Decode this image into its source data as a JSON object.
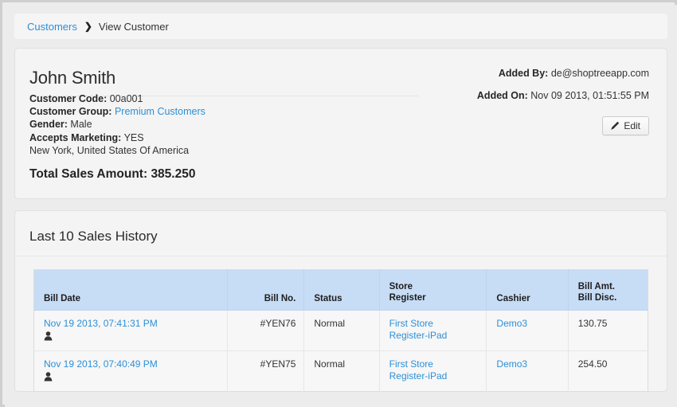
{
  "breadcrumb": {
    "root_label": "Customers",
    "separator": "❯",
    "current_label": "View Customer"
  },
  "customer": {
    "name": "John Smith",
    "fields": [
      {
        "label": "Customer Code:",
        "value": "00a001",
        "is_link": false
      },
      {
        "label": "Customer Group:",
        "value": "Premium Customers",
        "is_link": true
      },
      {
        "label": "Gender:",
        "value": "Male",
        "is_link": false
      },
      {
        "label": "Accepts Marketing:",
        "value": "YES",
        "is_link": false
      }
    ],
    "address": "New York, United States Of America",
    "total_sales_label": "Total Sales Amount:",
    "total_sales_value": "385.250",
    "added_by_label": "Added By:",
    "added_by_value": "de@shoptreeapp.com",
    "added_on_label": "Added On:",
    "added_on_value": "Nov 09 2013, 01:51:55 PM",
    "edit_label": "Edit"
  },
  "sales": {
    "title": "Last 10 Sales History",
    "columns": [
      {
        "key": "bill_date",
        "label": "Bill Date",
        "align": "left"
      },
      {
        "key": "bill_no",
        "label": "Bill No.",
        "align": "right"
      },
      {
        "key": "status",
        "label": "Status",
        "align": "left"
      },
      {
        "key": "store",
        "label_line1": "Store",
        "label_line2": "Register",
        "align": "left"
      },
      {
        "key": "cashier",
        "label": "Cashier",
        "align": "left"
      },
      {
        "key": "amount",
        "label_line1": "Bill Amt.",
        "label_line2": "Bill Disc.",
        "align": "left"
      }
    ],
    "rows": [
      {
        "bill_date": "Nov 19 2013, 07:41:31 PM",
        "bill_no": "#YEN76",
        "status": "Normal",
        "store_line1": "First Store",
        "store_line2": "Register-iPad",
        "cashier": "Demo3",
        "bill_amount": "130.75"
      },
      {
        "bill_date": "Nov 19 2013, 07:40:49 PM",
        "bill_no": "#YEN75",
        "status": "Normal",
        "store_line1": "First Store",
        "store_line2": "Register-iPad",
        "cashier": "Demo3",
        "bill_amount": "254.50"
      }
    ]
  },
  "colors": {
    "link": "#2c8fd6",
    "table_header_bg": "#c7dcf5",
    "page_bg": "#ececec",
    "panel_bg": "#f4f4f4"
  }
}
